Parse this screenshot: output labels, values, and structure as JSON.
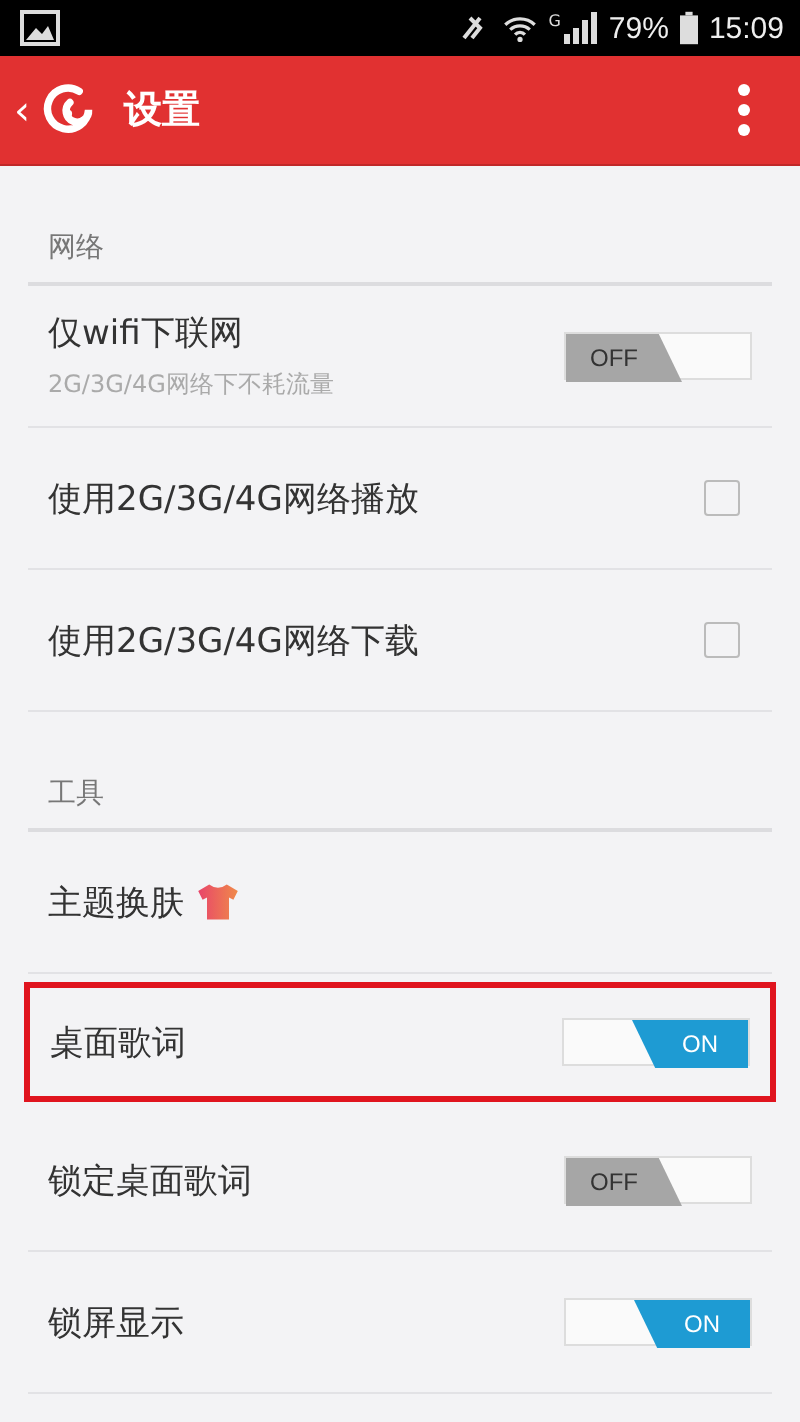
{
  "status_bar": {
    "network_type": "G",
    "battery": "79%",
    "time": "15:09"
  },
  "app_bar": {
    "back": "‹",
    "title": "设置"
  },
  "sections": [
    {
      "header": "网络",
      "items": [
        {
          "kind": "toggle",
          "title": "仅wifi下联网",
          "subtitle": "2G/3G/4G网络下不耗流量",
          "on": false,
          "label": "OFF",
          "highlighted": false
        },
        {
          "kind": "checkbox",
          "title": "使用2G/3G/4G网络播放",
          "checked": false,
          "highlighted": false
        },
        {
          "kind": "checkbox",
          "title": "使用2G/3G/4G网络下载",
          "checked": false,
          "highlighted": false
        }
      ]
    },
    {
      "header": "工具",
      "items": [
        {
          "kind": "theme",
          "title": "主题换肤",
          "highlighted": false
        },
        {
          "kind": "toggle",
          "title": "桌面歌词",
          "on": true,
          "label": "ON",
          "highlighted": true
        },
        {
          "kind": "toggle",
          "title": "锁定桌面歌词",
          "on": false,
          "label": "OFF",
          "highlighted": false
        },
        {
          "kind": "toggle",
          "title": "锁屏显示",
          "on": true,
          "label": "ON",
          "highlighted": false
        }
      ]
    }
  ]
}
